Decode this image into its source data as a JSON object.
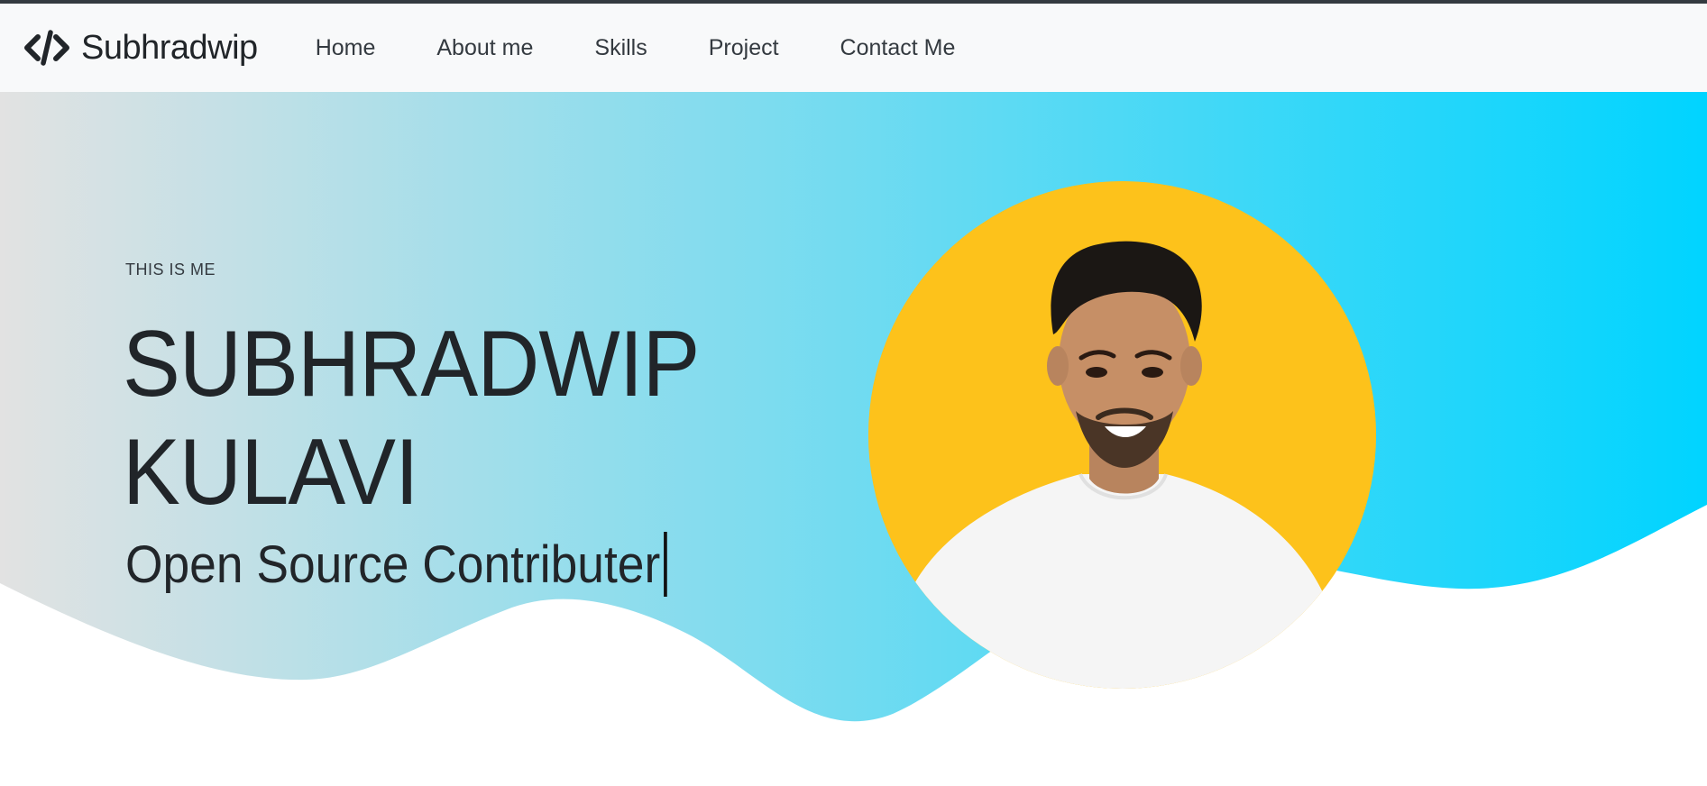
{
  "navbar": {
    "brand_icon": "code-icon",
    "brand_name": "Subhradwip",
    "links": [
      {
        "label": "Home"
      },
      {
        "label": "About me"
      },
      {
        "label": "Skills"
      },
      {
        "label": "Project"
      },
      {
        "label": "Contact Me"
      }
    ]
  },
  "hero": {
    "eyebrow": "THIS IS ME",
    "first_name": "SUBHRADWIP",
    "last_name": "KULAVI",
    "role": "Open Source Contributer",
    "avatar_icon": "profile-photo",
    "colors": {
      "gradient_start": "#e2e2e2",
      "gradient_end": "#00d4ff",
      "avatar_bg": "#fdc21b",
      "text": "#212529"
    }
  }
}
